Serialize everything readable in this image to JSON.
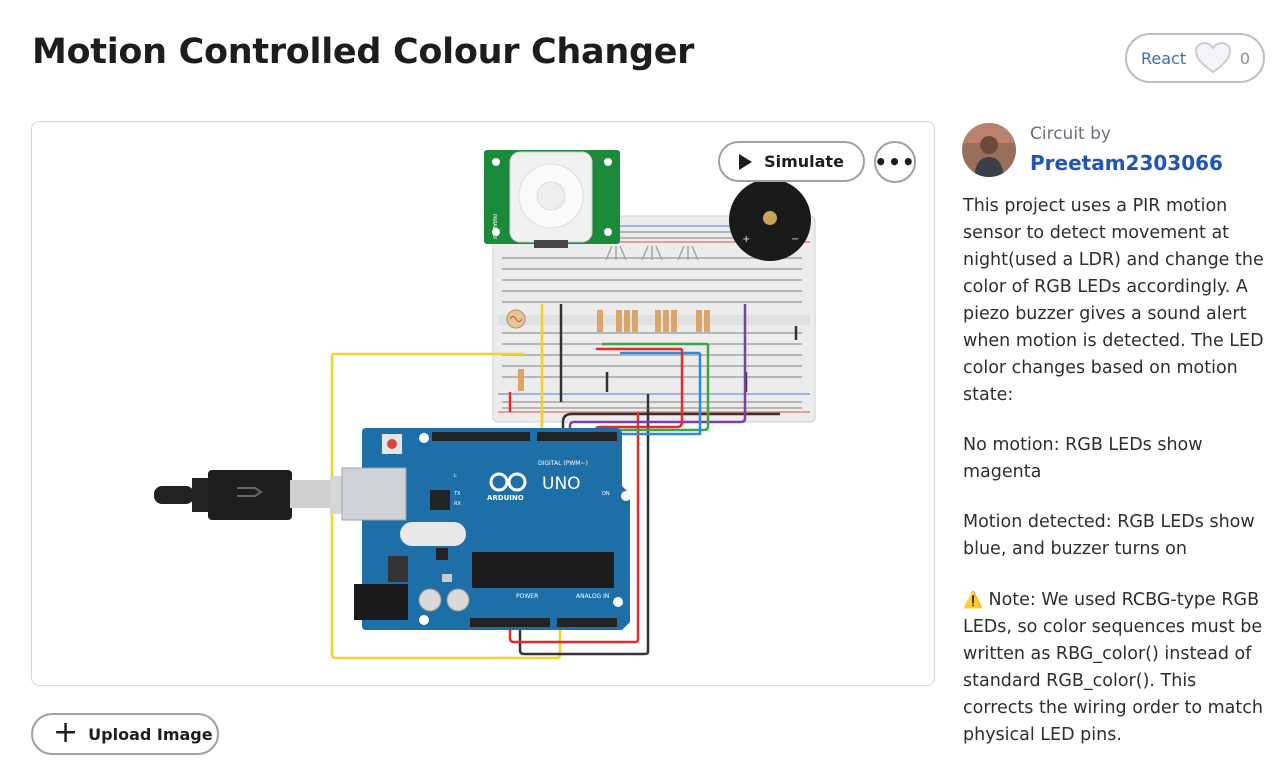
{
  "page": {
    "title": "Motion Controlled Colour Changer"
  },
  "react": {
    "label": "React",
    "count": "0",
    "icon": "heart-icon"
  },
  "viewer": {
    "simulate_label": "Simulate",
    "more_label": "•••"
  },
  "circuit": {
    "arduino_logo": "ARDUINO",
    "arduino_model": "UNO",
    "digital_label": "DIGITAL (PWM~)",
    "power_label": "POWER",
    "analog_label": "ANALOG IN",
    "on_label": "ON",
    "tx_label": "TX",
    "rx_label": "RX",
    "l_label": "L",
    "pir_label": "PARALLAX"
  },
  "upload": {
    "label": "Upload Image",
    "icon": "plus-icon"
  },
  "author": {
    "circuit_by": "Circuit by",
    "name": "Preetam2303066"
  },
  "description": {
    "intro": "This project uses a PIR motion sensor to detect movement at night(used a LDR) and change the color of RGB LEDs accordingly. A piezo buzzer gives a sound alert when motion is detected. The LED color changes based on motion state:",
    "no_motion": "No motion: RGB LEDs show magenta",
    "motion": "Motion detected: RGB LEDs show blue, and buzzer turns on",
    "note_icon": "⚠️",
    "note": "Note: We used RCBG-type RGB LEDs, so color sequences must be written as RBG_color() instead of standard RGB_color(). This corrects the wiring order to match physical LED pins."
  },
  "colors": {
    "author_link": "#1f55b8",
    "react_text": "#3a6fb0",
    "arduino_blue": "#1e6fa8",
    "pir_green": "#1b8a3a",
    "wire_yellow": "#f2d024",
    "wire_red": "#e32b2b",
    "wire_black": "#333333",
    "wire_purple": "#7b3fa8",
    "wire_green": "#3aa745",
    "wire_blue": "#2e8ad6"
  }
}
